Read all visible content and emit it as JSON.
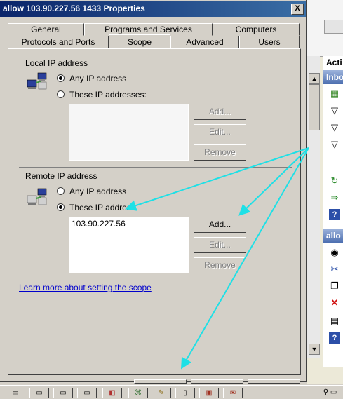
{
  "dialog": {
    "title": "allow 103.90.227.56 1433 Properties",
    "close_glyph": "X",
    "tabs_row1": [
      "General",
      "Programs and Services",
      "Computers"
    ],
    "tabs_row2": [
      "Protocols and Ports",
      "Scope",
      "Advanced",
      "Users"
    ],
    "selected_tab": "Scope",
    "local": {
      "label": "Local IP address",
      "option_any": "Any IP address",
      "option_these": "These IP addresses:",
      "selected": "any",
      "list": [],
      "buttons": {
        "add": "Add...",
        "edit": "Edit...",
        "remove": "Remove"
      }
    },
    "remote": {
      "label": "Remote IP address",
      "option_any": "Any IP address",
      "option_these": "These IP address",
      "selected": "these",
      "list": [
        "103.90.227.56"
      ],
      "buttons": {
        "add": "Add...",
        "edit": "Edit...",
        "remove": "Remove"
      }
    },
    "help_link": "Learn more about setting the scope"
  },
  "background_app": {
    "actions_header": "Acti",
    "inbound_band": "Inbo",
    "rule_band": "allo"
  },
  "annotation_color": "#1ee0e6"
}
